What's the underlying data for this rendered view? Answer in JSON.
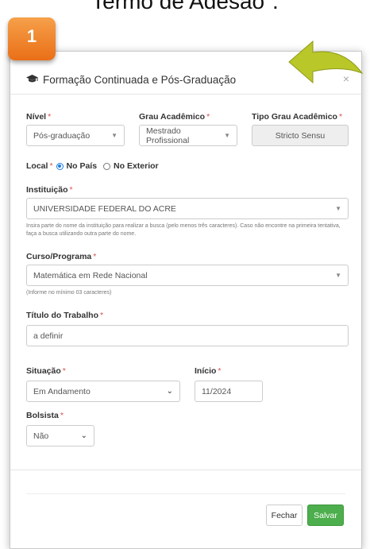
{
  "caption": "Termo de Adesão\".",
  "step_number": "1",
  "modal": {
    "title": "Formação Continuada e Pós-Graduação",
    "close_symbol": "×"
  },
  "form": {
    "nivel": {
      "label": "Nível",
      "required": "*",
      "value": "Pós-graduação"
    },
    "grau_academico": {
      "label": "Grau Acadêmico",
      "required": "*",
      "value": "Mestrado Profissional"
    },
    "tipo_grau": {
      "label": "Tipo Grau Acadêmico",
      "required": "*",
      "value": "Stricto Sensu"
    },
    "local": {
      "label": "Local",
      "required": "*",
      "option_1": "No País",
      "option_2": "No Exterior",
      "selected": "No País"
    },
    "instituicao": {
      "label": "Instituição",
      "required": "*",
      "value": "UNIVERSIDADE FEDERAL DO ACRE",
      "help": "Insira parte do nome da instituição para realizar a busca (pelo menos três caracteres). Caso não encontre na primeira tentativa, faça a busca utilizando outra parte do nome."
    },
    "curso": {
      "label": "Curso/Programa",
      "required": "*",
      "value": "Matemática em Rede Nacional",
      "help": "(Informe no mínimo 03 caracteres)"
    },
    "titulo": {
      "label": "Título do Trabalho",
      "required": "*",
      "value": "a definir"
    },
    "situacao": {
      "label": "Situação",
      "required": "*",
      "value": "Em Andamento"
    },
    "inicio": {
      "label": "Início",
      "required": "*",
      "value": "11/2024"
    },
    "bolsista": {
      "label": "Bolsista",
      "required": "*",
      "value": "Não"
    }
  },
  "footer": {
    "close_label": "Fechar",
    "save_label": "Salvar"
  },
  "colors": {
    "badge": "#ee7d1f",
    "arrow": "#b9c728",
    "save": "#4cae4c",
    "required": "#d9534f"
  }
}
